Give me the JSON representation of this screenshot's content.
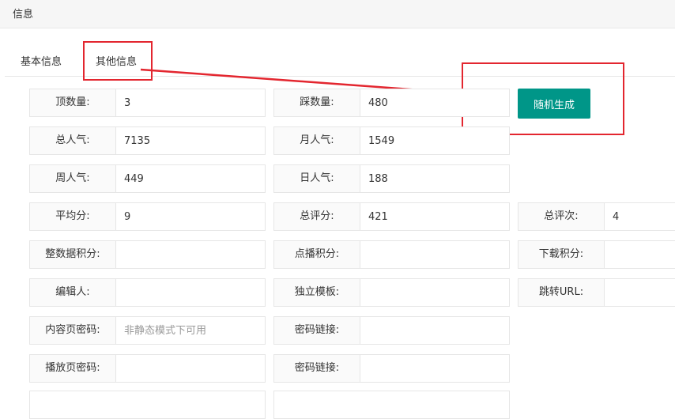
{
  "header": {
    "title": "信息"
  },
  "tabs": [
    {
      "label": "基本信息"
    },
    {
      "label": "其他信息"
    }
  ],
  "fields": {
    "ding": {
      "label": "顶数量:",
      "value": "3"
    },
    "cai": {
      "label": "踩数量:",
      "value": "480"
    },
    "hits": {
      "label": "总人气:",
      "value": "7135"
    },
    "hits_month": {
      "label": "月人气:",
      "value": "1549"
    },
    "hits_week": {
      "label": "周人气:",
      "value": "449"
    },
    "hits_day": {
      "label": "日人气:",
      "value": "188"
    },
    "score_avg": {
      "label": "平均分:",
      "value": "9"
    },
    "score_all": {
      "label": "总评分:",
      "value": "421"
    },
    "score_num": {
      "label": "总评次:",
      "value": "4"
    },
    "points": {
      "label": "整数据积分:",
      "value": ""
    },
    "points_play": {
      "label": "点播积分:",
      "value": ""
    },
    "points_down": {
      "label": "下载积分:",
      "value": ""
    },
    "editor": {
      "label": "编辑人:",
      "value": ""
    },
    "tpl": {
      "label": "独立模板:",
      "value": ""
    },
    "jumpurl": {
      "label": "跳转URL:",
      "value": ""
    },
    "pwd_detail": {
      "label": "内容页密码:",
      "value": "",
      "placeholder": "非静态模式下可用"
    },
    "pwd_link1": {
      "label": "密码链接:",
      "value": ""
    },
    "pwd_play": {
      "label": "播放页密码:",
      "value": ""
    },
    "pwd_link2": {
      "label": "密码链接:",
      "value": ""
    }
  },
  "actions": {
    "random_generate": "随机生成"
  },
  "colors": {
    "primary": "#009688",
    "highlight": "#e3262f"
  }
}
